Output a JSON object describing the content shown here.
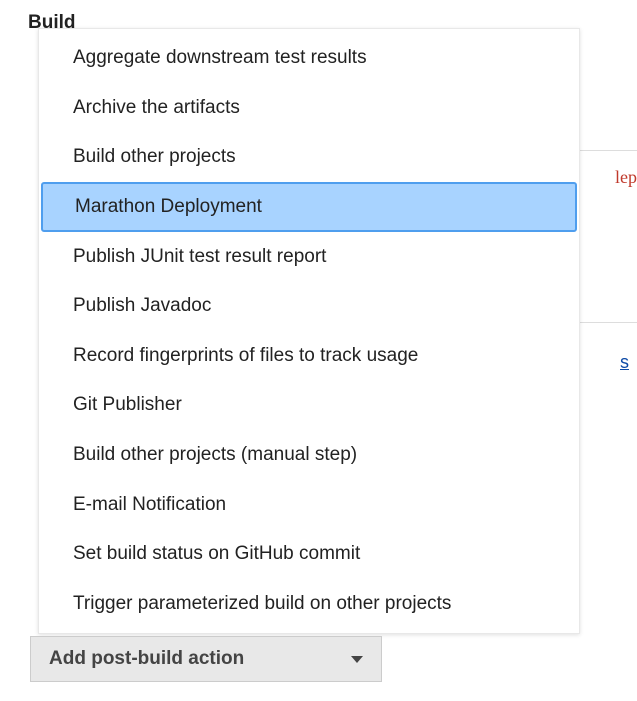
{
  "section_title": "Build",
  "dropdown": {
    "items": [
      {
        "label": "Aggregate downstream test results",
        "selected": false
      },
      {
        "label": "Archive the artifacts",
        "selected": false
      },
      {
        "label": "Build other projects",
        "selected": false
      },
      {
        "label": "Marathon Deployment",
        "selected": true
      },
      {
        "label": "Publish JUnit test result report",
        "selected": false
      },
      {
        "label": "Publish Javadoc",
        "selected": false
      },
      {
        "label": "Record fingerprints of files to track usage",
        "selected": false
      },
      {
        "label": "Git Publisher",
        "selected": false
      },
      {
        "label": "Build other projects (manual step)",
        "selected": false
      },
      {
        "label": "E-mail Notification",
        "selected": false
      },
      {
        "label": "Set build status on GitHub commit",
        "selected": false
      },
      {
        "label": "Trigger parameterized build on other projects",
        "selected": false
      }
    ]
  },
  "button": {
    "label": "Add post-build action"
  },
  "background": {
    "red_hint": "lep",
    "link_text": "s"
  }
}
